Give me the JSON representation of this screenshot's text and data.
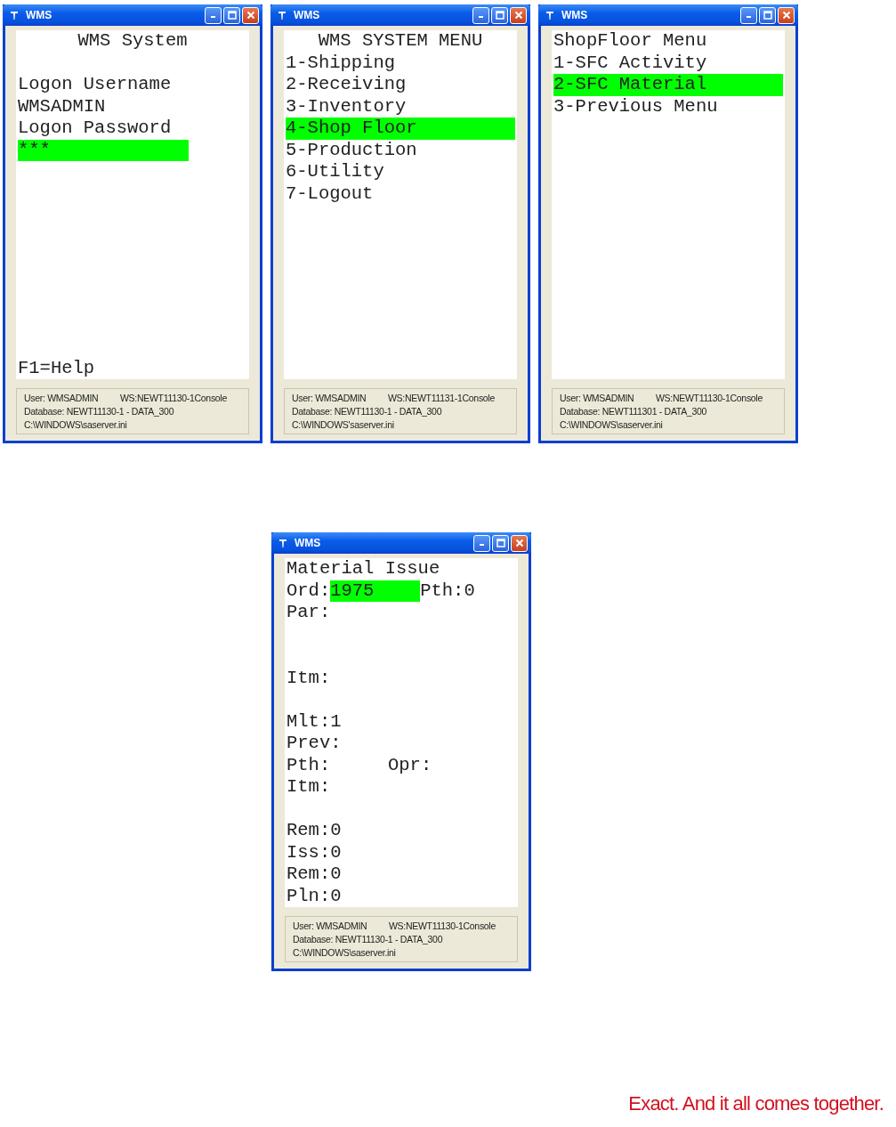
{
  "windows": [
    {
      "title": "WMS",
      "lines": [
        {
          "kind": "heading",
          "text": "WMS System"
        },
        {
          "kind": "blank"
        },
        {
          "kind": "text",
          "text": "Logon Username"
        },
        {
          "kind": "text",
          "text": "WMSADMIN"
        },
        {
          "kind": "text",
          "text": "Logon Password"
        },
        {
          "kind": "field",
          "text": "***",
          "focused": true
        },
        {
          "kind": "footer",
          "text": "F1=Help"
        }
      ],
      "status": {
        "user": "User: WMSADMIN",
        "ws": "WS:NEWT11130-1Console",
        "database": "Database: NEWT11130-1 - DATA_300",
        "path": "C:\\WINDOWS\\saserver.ini"
      }
    },
    {
      "title": "WMS",
      "lines": [
        {
          "kind": "heading",
          "text": "WMS SYSTEM MENU"
        },
        {
          "kind": "menu",
          "text": "1-Shipping",
          "selected": false
        },
        {
          "kind": "menu",
          "text": "2-Receiving",
          "selected": false
        },
        {
          "kind": "menu",
          "text": "3-Inventory",
          "selected": false
        },
        {
          "kind": "menu",
          "text": "4-Shop Floor",
          "selected": true
        },
        {
          "kind": "menu",
          "text": "5-Production",
          "selected": false
        },
        {
          "kind": "menu",
          "text": "6-Utility",
          "selected": false
        },
        {
          "kind": "menu",
          "text": "7-Logout",
          "selected": false
        }
      ],
      "status": {
        "user": "User: WMSADMIN",
        "ws": "WS:NEWT11131-1Console",
        "database": "Database: NEWT11130-1 - DATA_300",
        "path": "C:\\WINDOWS'saserver.ini"
      }
    },
    {
      "title": "WMS",
      "lines": [
        {
          "kind": "text",
          "text": "ShopFloor Menu"
        },
        {
          "kind": "menu",
          "text": "1-SFC Activity",
          "selected": false
        },
        {
          "kind": "menu",
          "text": "2-SFC Material",
          "selected": true
        },
        {
          "kind": "menu",
          "text": "3-Previous Menu",
          "selected": false
        }
      ],
      "status": {
        "user": "User: WMSADMIN",
        "ws": "WS:NEWT11130-1Console",
        "database": "Database: NEWT111301 - DATA_300",
        "path": "C:\\WINDOWS\\saserver.ini"
      }
    },
    {
      "title": "WMS",
      "lines": [
        {
          "kind": "text",
          "text": "Material Issue"
        },
        {
          "kind": "row",
          "parts": [
            {
              "kind": "label",
              "text": "Ord:"
            },
            {
              "kind": "field",
              "text": "1975",
              "focused": true
            },
            {
              "kind": "label",
              "text": "Pth:0"
            }
          ]
        },
        {
          "kind": "text",
          "text": "Par:"
        },
        {
          "kind": "blank"
        },
        {
          "kind": "blank"
        },
        {
          "kind": "text",
          "text": "Itm:"
        },
        {
          "kind": "blank"
        },
        {
          "kind": "text",
          "text": "Mlt:1"
        },
        {
          "kind": "text",
          "text": "Prev:"
        },
        {
          "kind": "row",
          "parts": [
            {
              "kind": "cell",
              "text": "Pth:"
            },
            {
              "kind": "label",
              "text": "Opr:"
            }
          ]
        },
        {
          "kind": "text",
          "text": "Itm:"
        },
        {
          "kind": "blank"
        },
        {
          "kind": "text",
          "text": "Rem:0"
        },
        {
          "kind": "text",
          "text": "Iss:0"
        },
        {
          "kind": "text",
          "text": "Rem:0"
        },
        {
          "kind": "text",
          "text": "Pln:0"
        }
      ],
      "status": {
        "user": "User: WMSADMIN",
        "ws": "WS:NEWT11130-1Console",
        "database": "Database: NEWT11130-1 - DATA_300",
        "path": "C:\\WINDOWS\\saserver.ini"
      }
    }
  ],
  "tagline": "Exact. And it all comes together."
}
